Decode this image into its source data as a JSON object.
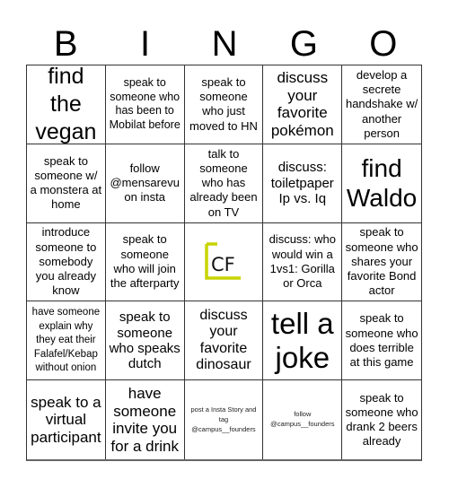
{
  "header": {
    "letters": [
      "B",
      "I",
      "N",
      "G",
      "O"
    ]
  },
  "colors": {
    "logo_accent": "#c8d400",
    "logo_text": "#111111",
    "grid_line": "#333333"
  },
  "cells": [
    {
      "text": "find the vegan"
    },
    {
      "text": "speak to someone who has been to Mobilat before"
    },
    {
      "text": "speak to someone who just moved to HN"
    },
    {
      "text": "discuss your favorite pokémon"
    },
    {
      "text": "develop a secrete handshake w/ another person"
    },
    {
      "text": "speak to someone w/ a monstera at home"
    },
    {
      "text": "follow @mensarevu on insta"
    },
    {
      "text": "talk to someone who has already been on TV"
    },
    {
      "text": "discuss: toiletpaper Ip vs. Iq"
    },
    {
      "text": "find Waldo"
    },
    {
      "text": "introduce someone to somebody you already know"
    },
    {
      "text": "speak to someone who will join the afterparty"
    },
    {
      "text": "",
      "free_space": true,
      "logo_text": "CF"
    },
    {
      "text": "discuss: who would win a 1vs1: Gorilla or Orca"
    },
    {
      "text": "speak to someone who shares your favorite Bond actor"
    },
    {
      "text": "have someone explain why they eat their Falafel/Kebap without onion"
    },
    {
      "text": "speak to someone who speaks dutch"
    },
    {
      "text": "discuss your favorite dinosaur"
    },
    {
      "text": "tell a joke"
    },
    {
      "text": "speak to someone who does terrible at this game"
    },
    {
      "text": "speak to a virtual participant"
    },
    {
      "text": "have someone invite you for a drink"
    },
    {
      "text": "post a Insta Story and tag @campus__founders"
    },
    {
      "text": "follow @campus__founders"
    },
    {
      "text": "speak to someone who drank 2 beers already"
    }
  ]
}
